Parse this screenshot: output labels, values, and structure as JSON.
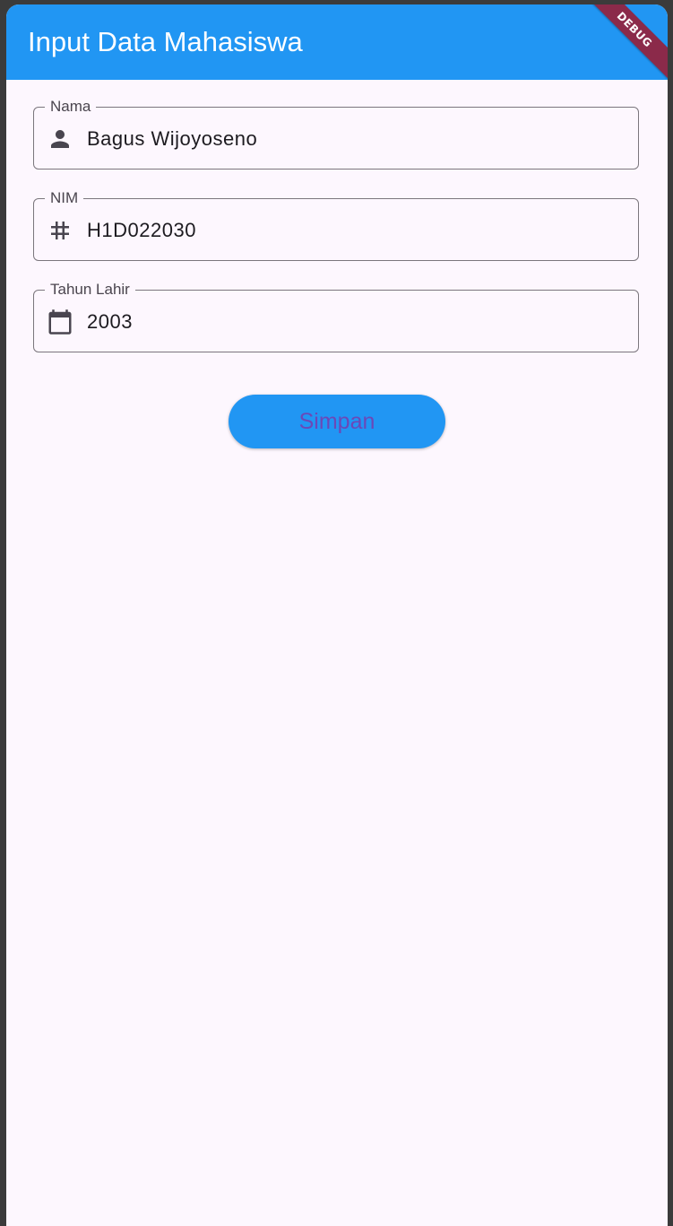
{
  "app_bar": {
    "title": "Input Data Mahasiswa",
    "debug_banner": "DEBUG"
  },
  "form": {
    "fields": [
      {
        "label": "Nama",
        "value": "Bagus Wijoyoseno",
        "icon": "person-icon"
      },
      {
        "label": "NIM",
        "value": "H1D022030",
        "icon": "tag-icon"
      },
      {
        "label": "Tahun Lahir",
        "value": "2003",
        "icon": "calendar-icon"
      }
    ],
    "save_label": "Simpan"
  },
  "colors": {
    "app_bar": "#2196f3",
    "background": "#fdf7fe",
    "button_background": "#2196f3",
    "button_text": "#6b48b8",
    "debug_banner": "#8b2a4a"
  }
}
